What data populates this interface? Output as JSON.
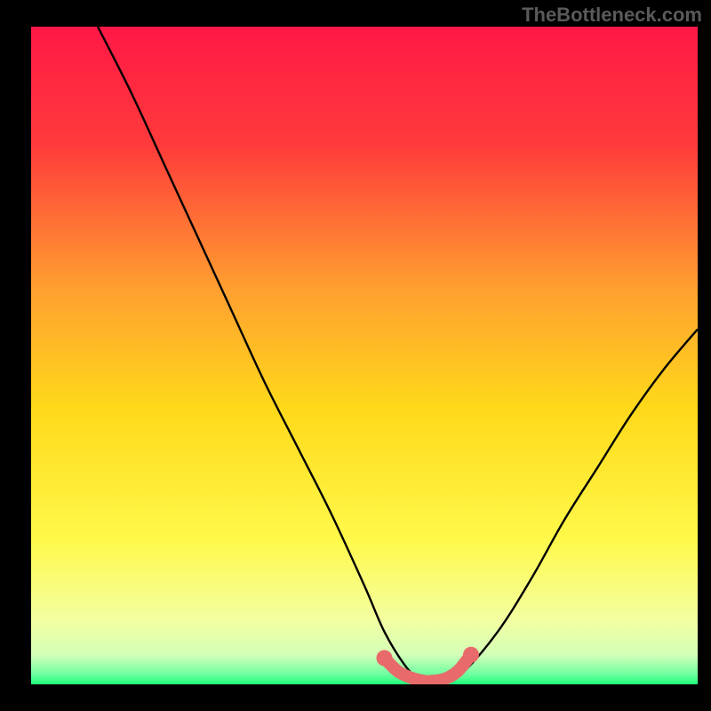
{
  "watermark": "TheBottleneck.com",
  "gradient": {
    "stops": [
      {
        "offset": 0,
        "color": "#ff1846"
      },
      {
        "offset": 0.18,
        "color": "#ff3b3b"
      },
      {
        "offset": 0.4,
        "color": "#ffa030"
      },
      {
        "offset": 0.58,
        "color": "#ffd91a"
      },
      {
        "offset": 0.78,
        "color": "#fff94a"
      },
      {
        "offset": 0.9,
        "color": "#f3ffa0"
      },
      {
        "offset": 0.955,
        "color": "#d4ffb8"
      },
      {
        "offset": 0.985,
        "color": "#6effa0"
      },
      {
        "offset": 1.0,
        "color": "#1eff7a"
      }
    ]
  },
  "chart_data": {
    "type": "line",
    "title": "",
    "xlabel": "",
    "ylabel": "",
    "xlim": [
      0,
      100
    ],
    "ylim": [
      0,
      100
    ],
    "series": [
      {
        "name": "bottleneck-curve",
        "x": [
          10,
          15,
          20,
          25,
          30,
          35,
          40,
          45,
          50,
          53,
          56,
          58,
          60,
          62,
          65,
          70,
          75,
          80,
          85,
          90,
          95,
          100
        ],
        "y": [
          100,
          90,
          79,
          68,
          57,
          46,
          36,
          26,
          15,
          8,
          3,
          1,
          0,
          0,
          2,
          8,
          16,
          25,
          33,
          41,
          48,
          54
        ]
      }
    ],
    "highlight_segment": {
      "name": "trough-band",
      "color": "#e96a6a",
      "x": [
        53,
        55,
        57,
        59,
        60,
        62,
        64,
        66
      ],
      "y": [
        4,
        2,
        1,
        0.5,
        0.5,
        0.8,
        2,
        4.5
      ]
    }
  }
}
